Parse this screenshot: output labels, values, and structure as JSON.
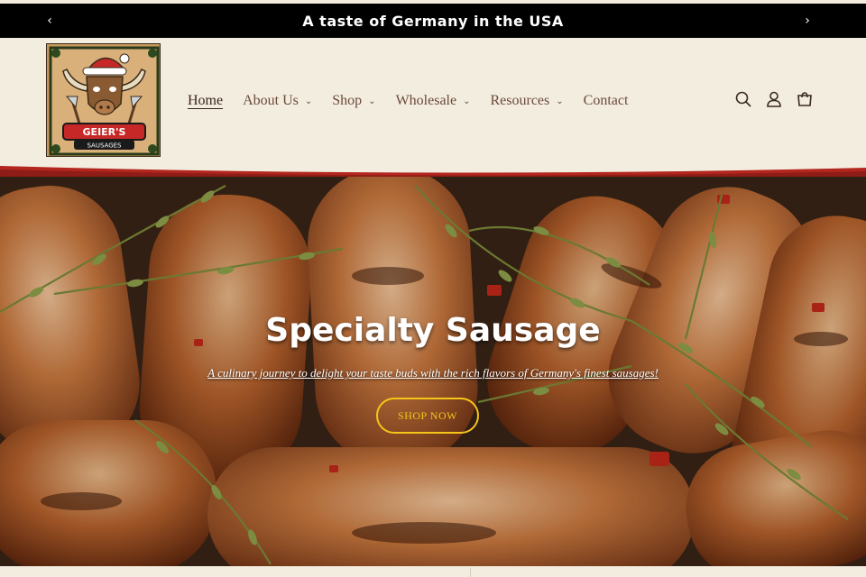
{
  "announcement": {
    "text": "A taste of Germany in the USA",
    "prev_icon": "chevron-left-icon",
    "next_icon": "chevron-right-icon"
  },
  "logo": {
    "name": "GEIER'S",
    "tagline": "SAUSAGES"
  },
  "nav": {
    "items": [
      {
        "label": "Home",
        "active": true,
        "dropdown": false
      },
      {
        "label": "About Us",
        "active": false,
        "dropdown": true
      },
      {
        "label": "Shop",
        "active": false,
        "dropdown": true
      },
      {
        "label": "Wholesale",
        "active": false,
        "dropdown": true
      },
      {
        "label": "Resources",
        "active": false,
        "dropdown": true
      },
      {
        "label": "Contact",
        "active": false,
        "dropdown": false
      }
    ]
  },
  "header_icons": [
    "search-icon",
    "account-icon",
    "cart-icon"
  ],
  "hero": {
    "title": "Specialty Sausage",
    "subtitle": "A culinary journey to delight your taste buds with the rich flavors of Germany's finest sausages!",
    "button_label": "SHOP NOW"
  },
  "colors": {
    "announcement_bg": "#000000",
    "header_bg": "#f3ede0",
    "accent_red": "#b3261e",
    "button_yellow": "#f5c518",
    "nav_text": "#6b4a3a"
  }
}
